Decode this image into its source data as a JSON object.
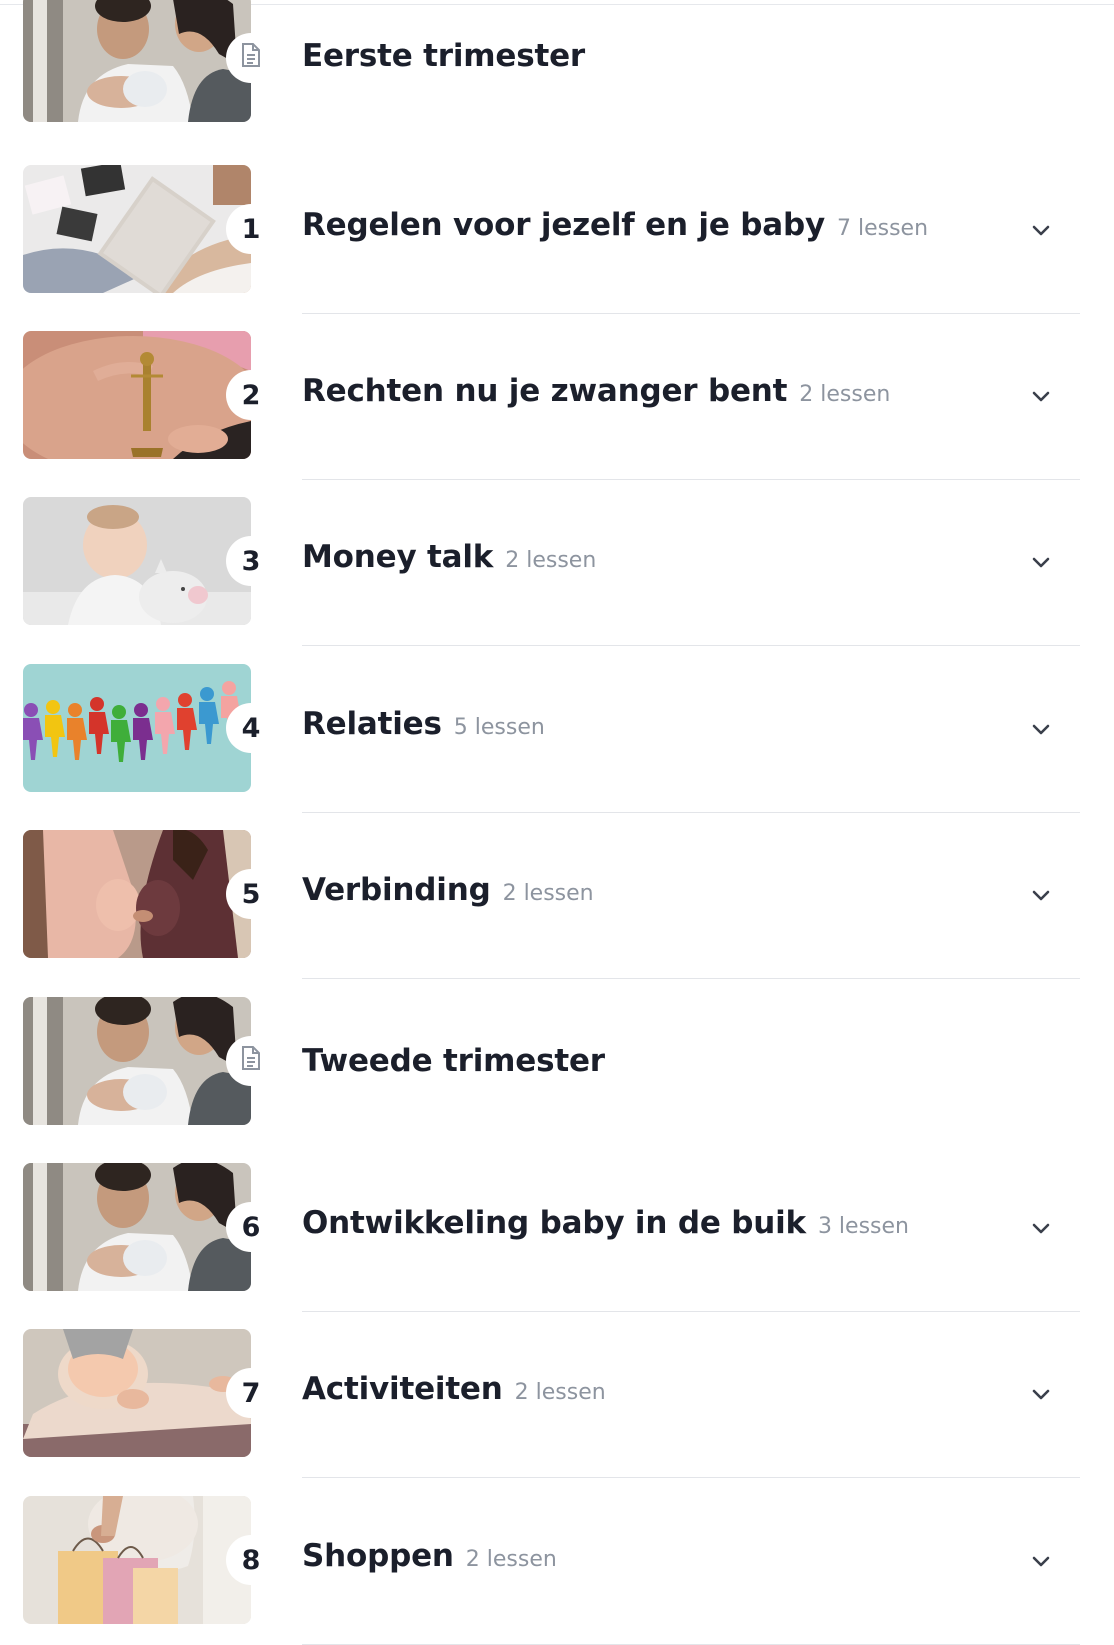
{
  "items": [
    {
      "type": "section",
      "title": "Eerste trimester",
      "photo": "parents-with-newborn",
      "badge_icon": "document-icon"
    },
    {
      "type": "module",
      "number": "1",
      "title": "Regelen voor jezelf en je baby",
      "count": "7 lessen",
      "photo": "notebook-ultrasound-belly"
    },
    {
      "type": "module",
      "number": "2",
      "title": "Rechten nu je zwanger bent",
      "count": "2 lessen",
      "photo": "justice-statue-belly"
    },
    {
      "type": "module",
      "number": "3",
      "title": "Money talk",
      "count": "2 lessen",
      "photo": "baby-piggy-bank"
    },
    {
      "type": "module",
      "number": "4",
      "title": "Relaties",
      "count": "5 lessen",
      "photo": "paper-people-chain"
    },
    {
      "type": "module",
      "number": "5",
      "title": "Verbinding",
      "count": "2 lessen",
      "photo": "two-pregnant-women"
    },
    {
      "type": "section",
      "title": "Tweede trimester",
      "photo": "parents-with-newborn",
      "badge_icon": "document-icon"
    },
    {
      "type": "module",
      "number": "6",
      "title": "Ontwikkeling baby in de buik",
      "count": "3 lessen",
      "photo": "parents-with-newborn"
    },
    {
      "type": "module",
      "number": "7",
      "title": "Activiteiten",
      "count": "2 lessen",
      "photo": "pregnant-yoga"
    },
    {
      "type": "module",
      "number": "8",
      "title": "Shoppen",
      "count": "2 lessen",
      "photo": "shopping-bags-belly"
    }
  ],
  "colors": {
    "text": "#1b1f2b",
    "muted": "#8d949f",
    "divider": "#e3e5e9"
  }
}
